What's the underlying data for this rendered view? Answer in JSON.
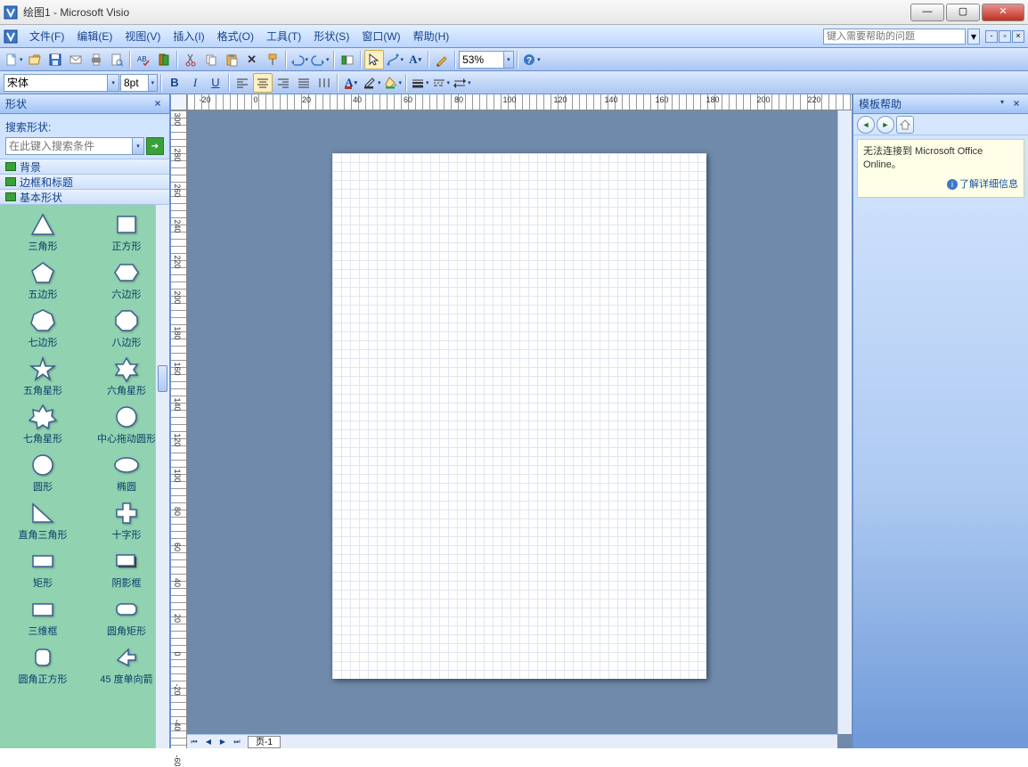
{
  "app": {
    "title": "绘图1 - Microsoft Visio"
  },
  "menu": {
    "items": [
      {
        "label": "文件(F)",
        "key": "file"
      },
      {
        "label": "编辑(E)",
        "key": "edit"
      },
      {
        "label": "视图(V)",
        "key": "view"
      },
      {
        "label": "插入(I)",
        "key": "insert"
      },
      {
        "label": "格式(O)",
        "key": "format"
      },
      {
        "label": "工具(T)",
        "key": "tools"
      },
      {
        "label": "形状(S)",
        "key": "shapes"
      },
      {
        "label": "窗口(W)",
        "key": "window"
      },
      {
        "label": "帮助(H)",
        "key": "help"
      }
    ],
    "help_search_placeholder": "键入需要帮助的问题"
  },
  "toolbar_std": {
    "zoom": "53%"
  },
  "toolbar_fmt": {
    "font": "宋体",
    "size": "8pt"
  },
  "shapes_pane": {
    "title": "形状",
    "search_label": "搜索形状:",
    "search_placeholder": "在此键入搜索条件",
    "stencils": [
      {
        "label": "背景",
        "key": "bg"
      },
      {
        "label": "边框和标题",
        "key": "borders"
      },
      {
        "label": "基本形状",
        "key": "basic"
      }
    ],
    "shapes": [
      {
        "label": "三角形",
        "kind": "triangle"
      },
      {
        "label": "正方形",
        "kind": "square"
      },
      {
        "label": "五边形",
        "kind": "pentagon"
      },
      {
        "label": "六边形",
        "kind": "hexagon"
      },
      {
        "label": "七边形",
        "kind": "heptagon"
      },
      {
        "label": "八边形",
        "kind": "octagon"
      },
      {
        "label": "五角星形",
        "kind": "star5"
      },
      {
        "label": "六角星形",
        "kind": "star6"
      },
      {
        "label": "七角星形",
        "kind": "star7"
      },
      {
        "label": "中心拖动圆形",
        "kind": "cdcircle"
      },
      {
        "label": "圆形",
        "kind": "circle"
      },
      {
        "label": "椭圆",
        "kind": "ellipse"
      },
      {
        "label": "直角三角形",
        "kind": "rtriangle"
      },
      {
        "label": "十字形",
        "kind": "cross"
      },
      {
        "label": "矩形",
        "kind": "rect"
      },
      {
        "label": "阴影框",
        "kind": "shadowbox"
      },
      {
        "label": "三维框",
        "kind": "box3d"
      },
      {
        "label": "圆角矩形",
        "kind": "roundrect"
      },
      {
        "label": "圆角正方形",
        "kind": "roundsquare"
      },
      {
        "label": "45 度单向箭",
        "kind": "arrow45"
      }
    ]
  },
  "ruler_h_ticks": [
    "-20",
    "0",
    "20",
    "40",
    "60",
    "80",
    "100",
    "120",
    "140",
    "160",
    "180",
    "200",
    "220"
  ],
  "ruler_v_ticks": [
    "300",
    "280",
    "260",
    "240",
    "220",
    "200",
    "180",
    "160",
    "140",
    "120",
    "100",
    "80",
    "60",
    "40",
    "20",
    "0",
    "-20",
    "-40",
    "-60"
  ],
  "page_tab": "页-1",
  "help_pane": {
    "title": "模板帮助",
    "msg": "无法连接到 Microsoft Office Online。",
    "link": "了解详细信息"
  }
}
